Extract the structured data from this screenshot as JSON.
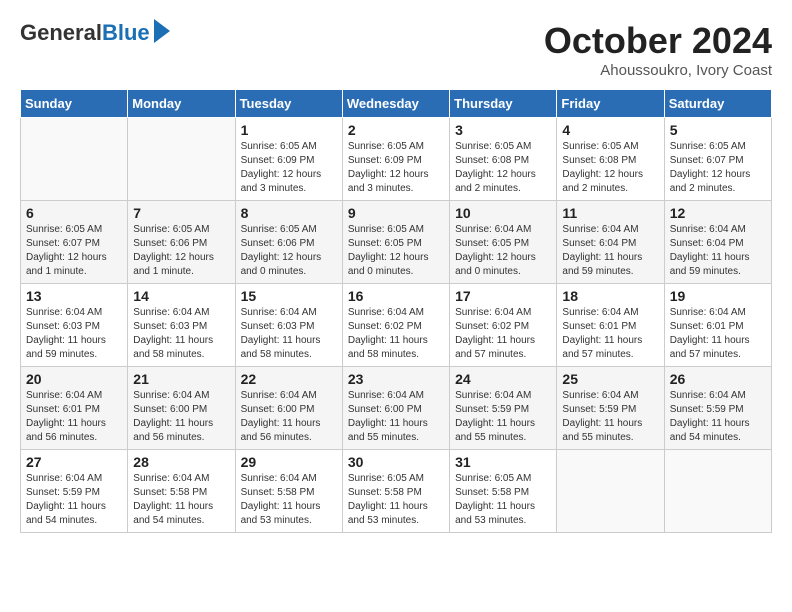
{
  "header": {
    "logo_general": "General",
    "logo_blue": "Blue",
    "month_title": "October 2024",
    "subtitle": "Ahoussoukro, Ivory Coast"
  },
  "days_of_week": [
    "Sunday",
    "Monday",
    "Tuesday",
    "Wednesday",
    "Thursday",
    "Friday",
    "Saturday"
  ],
  "weeks": [
    [
      {
        "day": "",
        "info": ""
      },
      {
        "day": "",
        "info": ""
      },
      {
        "day": "1",
        "info": "Sunrise: 6:05 AM\nSunset: 6:09 PM\nDaylight: 12 hours and 3 minutes."
      },
      {
        "day": "2",
        "info": "Sunrise: 6:05 AM\nSunset: 6:09 PM\nDaylight: 12 hours and 3 minutes."
      },
      {
        "day": "3",
        "info": "Sunrise: 6:05 AM\nSunset: 6:08 PM\nDaylight: 12 hours and 2 minutes."
      },
      {
        "day": "4",
        "info": "Sunrise: 6:05 AM\nSunset: 6:08 PM\nDaylight: 12 hours and 2 minutes."
      },
      {
        "day": "5",
        "info": "Sunrise: 6:05 AM\nSunset: 6:07 PM\nDaylight: 12 hours and 2 minutes."
      }
    ],
    [
      {
        "day": "6",
        "info": "Sunrise: 6:05 AM\nSunset: 6:07 PM\nDaylight: 12 hours and 1 minute."
      },
      {
        "day": "7",
        "info": "Sunrise: 6:05 AM\nSunset: 6:06 PM\nDaylight: 12 hours and 1 minute."
      },
      {
        "day": "8",
        "info": "Sunrise: 6:05 AM\nSunset: 6:06 PM\nDaylight: 12 hours and 0 minutes."
      },
      {
        "day": "9",
        "info": "Sunrise: 6:05 AM\nSunset: 6:05 PM\nDaylight: 12 hours and 0 minutes."
      },
      {
        "day": "10",
        "info": "Sunrise: 6:04 AM\nSunset: 6:05 PM\nDaylight: 12 hours and 0 minutes."
      },
      {
        "day": "11",
        "info": "Sunrise: 6:04 AM\nSunset: 6:04 PM\nDaylight: 11 hours and 59 minutes."
      },
      {
        "day": "12",
        "info": "Sunrise: 6:04 AM\nSunset: 6:04 PM\nDaylight: 11 hours and 59 minutes."
      }
    ],
    [
      {
        "day": "13",
        "info": "Sunrise: 6:04 AM\nSunset: 6:03 PM\nDaylight: 11 hours and 59 minutes."
      },
      {
        "day": "14",
        "info": "Sunrise: 6:04 AM\nSunset: 6:03 PM\nDaylight: 11 hours and 58 minutes."
      },
      {
        "day": "15",
        "info": "Sunrise: 6:04 AM\nSunset: 6:03 PM\nDaylight: 11 hours and 58 minutes."
      },
      {
        "day": "16",
        "info": "Sunrise: 6:04 AM\nSunset: 6:02 PM\nDaylight: 11 hours and 58 minutes."
      },
      {
        "day": "17",
        "info": "Sunrise: 6:04 AM\nSunset: 6:02 PM\nDaylight: 11 hours and 57 minutes."
      },
      {
        "day": "18",
        "info": "Sunrise: 6:04 AM\nSunset: 6:01 PM\nDaylight: 11 hours and 57 minutes."
      },
      {
        "day": "19",
        "info": "Sunrise: 6:04 AM\nSunset: 6:01 PM\nDaylight: 11 hours and 57 minutes."
      }
    ],
    [
      {
        "day": "20",
        "info": "Sunrise: 6:04 AM\nSunset: 6:01 PM\nDaylight: 11 hours and 56 minutes."
      },
      {
        "day": "21",
        "info": "Sunrise: 6:04 AM\nSunset: 6:00 PM\nDaylight: 11 hours and 56 minutes."
      },
      {
        "day": "22",
        "info": "Sunrise: 6:04 AM\nSunset: 6:00 PM\nDaylight: 11 hours and 56 minutes."
      },
      {
        "day": "23",
        "info": "Sunrise: 6:04 AM\nSunset: 6:00 PM\nDaylight: 11 hours and 55 minutes."
      },
      {
        "day": "24",
        "info": "Sunrise: 6:04 AM\nSunset: 5:59 PM\nDaylight: 11 hours and 55 minutes."
      },
      {
        "day": "25",
        "info": "Sunrise: 6:04 AM\nSunset: 5:59 PM\nDaylight: 11 hours and 55 minutes."
      },
      {
        "day": "26",
        "info": "Sunrise: 6:04 AM\nSunset: 5:59 PM\nDaylight: 11 hours and 54 minutes."
      }
    ],
    [
      {
        "day": "27",
        "info": "Sunrise: 6:04 AM\nSunset: 5:59 PM\nDaylight: 11 hours and 54 minutes."
      },
      {
        "day": "28",
        "info": "Sunrise: 6:04 AM\nSunset: 5:58 PM\nDaylight: 11 hours and 54 minutes."
      },
      {
        "day": "29",
        "info": "Sunrise: 6:04 AM\nSunset: 5:58 PM\nDaylight: 11 hours and 53 minutes."
      },
      {
        "day": "30",
        "info": "Sunrise: 6:05 AM\nSunset: 5:58 PM\nDaylight: 11 hours and 53 minutes."
      },
      {
        "day": "31",
        "info": "Sunrise: 6:05 AM\nSunset: 5:58 PM\nDaylight: 11 hours and 53 minutes."
      },
      {
        "day": "",
        "info": ""
      },
      {
        "day": "",
        "info": ""
      }
    ]
  ]
}
